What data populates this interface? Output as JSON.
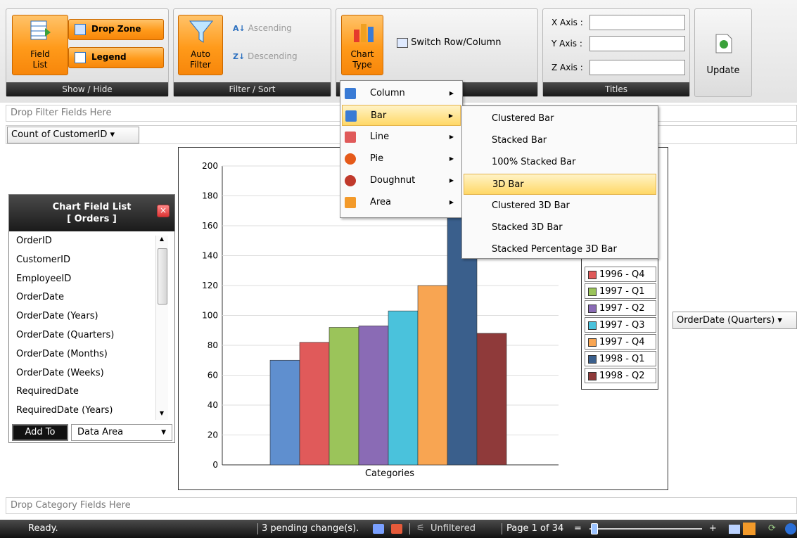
{
  "ribbon": {
    "show_hide": {
      "field_list": "Field\nList",
      "drop_zone": "Drop Zone",
      "legend": "Legend",
      "footer": "Show / Hide"
    },
    "filter_sort": {
      "auto_filter": "Auto\nFilter",
      "ascending": "Ascending",
      "descending": "Descending",
      "footer": "Filter / Sort"
    },
    "chart": {
      "chart_type": "Chart\nType",
      "switch": "Switch Row/Column"
    },
    "titles": {
      "x": "X Axis :",
      "y": "Y Axis :",
      "z": "Z Axis :",
      "footer": "Titles"
    },
    "update": "Update"
  },
  "zones": {
    "filter": "Drop Filter Fields Here",
    "data": "Count of CustomerID ▾",
    "category": "Drop Category Fields Here",
    "series": "OrderDate (Quarters) ▾"
  },
  "chart_type_menu": [
    {
      "label": "Column",
      "icon": "column-chart-icon"
    },
    {
      "label": "Bar",
      "icon": "bar-chart-icon"
    },
    {
      "label": "Line",
      "icon": "line-chart-icon"
    },
    {
      "label": "Pie",
      "icon": "pie-chart-icon"
    },
    {
      "label": "Doughnut",
      "icon": "doughnut-chart-icon"
    },
    {
      "label": "Area",
      "icon": "area-chart-icon"
    }
  ],
  "bar_submenu": [
    "Clustered Bar",
    "Stacked Bar",
    "100% Stacked Bar",
    "3D Bar",
    "Clustered 3D Bar",
    "Stacked 3D Bar",
    "Stacked Percentage 3D Bar"
  ],
  "field_list": {
    "title": "Chart Field List",
    "subtitle": "[ Orders ]",
    "items": [
      "OrderID",
      "CustomerID",
      "EmployeeID",
      "OrderDate",
      "OrderDate (Years)",
      "OrderDate (Quarters)",
      "OrderDate (Months)",
      "OrderDate (Weeks)",
      "RequiredDate",
      "RequiredDate (Years)"
    ],
    "add_to": "Add To",
    "area": "Data Area"
  },
  "chart_data": {
    "type": "bar",
    "xlabel": "Categories",
    "ylim": [
      0,
      200
    ],
    "yticks": [
      "0",
      "20",
      "40",
      "60",
      "80",
      "100",
      "120",
      "140",
      "160",
      "180",
      "200"
    ],
    "series": [
      {
        "name": "1996 - Q4",
        "value": 82,
        "color": "#e05a5a"
      },
      {
        "name": "1997 - Q1",
        "value": 92,
        "color": "#9bc45a"
      },
      {
        "name": "1997 - Q2",
        "value": 93,
        "color": "#8a6bb5"
      },
      {
        "name": "1997 - Q3",
        "value": 103,
        "color": "#4ac2dc"
      },
      {
        "name": "1997 - Q4",
        "value": 120,
        "color": "#f8a552"
      },
      {
        "name": "1998 - Q1",
        "value": 190,
        "color": "#3a5f8c"
      },
      {
        "name": "1998 - Q2",
        "value": 88,
        "color": "#8f3a3a"
      }
    ],
    "first_bar": {
      "value": 70,
      "color": "#5f8fcf"
    }
  },
  "status": {
    "ready": "Ready.",
    "pending": "3 pending change(s).",
    "unfiltered": "Unfiltered",
    "page": "Page 1 of 34"
  }
}
